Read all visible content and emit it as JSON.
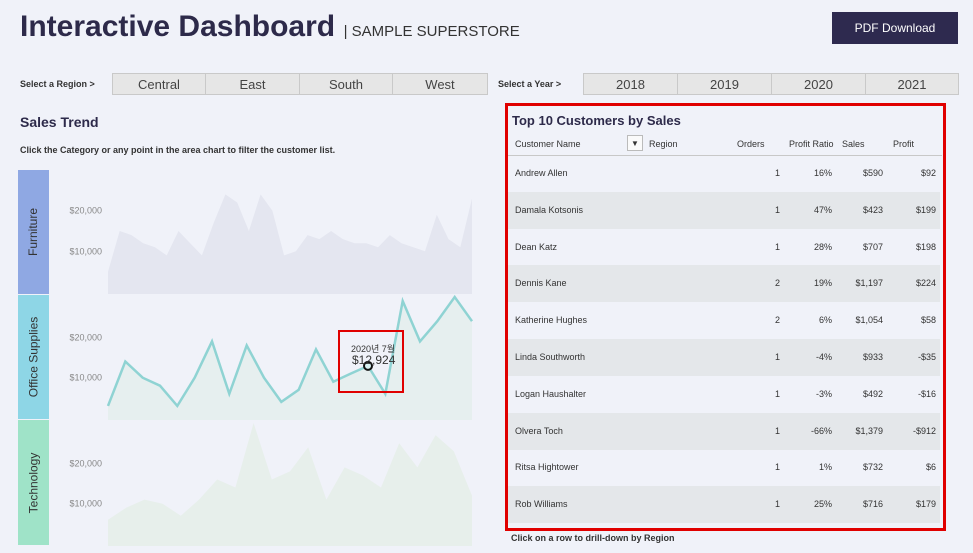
{
  "header": {
    "title": "Interactive Dashboard",
    "subtitle": "| SAMPLE SUPERSTORE",
    "pdf_button": "PDF Download"
  },
  "region_filter": {
    "label": "Select a Region >",
    "options": [
      "Central",
      "East",
      "South",
      "West"
    ]
  },
  "year_filter": {
    "label": "Select a Year >",
    "options": [
      "2018",
      "2019",
      "2020",
      "2021"
    ]
  },
  "sales_trend": {
    "title": "Sales Trend",
    "hint": "Click the Category or any point in the area chart to filter the customer list.",
    "categories": [
      "Furniture",
      "Office Supplies",
      "Technology"
    ],
    "axis_labels": [
      "$20,000",
      "$10,000"
    ],
    "tooltip": {
      "date": "2020년 7월",
      "value": "$12,924"
    }
  },
  "chart_data": {
    "type": "area",
    "title": "Sales Trend",
    "ylabel": "",
    "yticks": [
      10000,
      20000
    ],
    "series": [
      {
        "name": "Furniture",
        "values": [
          5000,
          15000,
          14000,
          12000,
          11000,
          9000,
          15000,
          12000,
          9000,
          17000,
          24000,
          22000,
          15000,
          24000,
          20000,
          9000,
          10000,
          14000,
          13000,
          15000,
          13000,
          12000,
          12000,
          11000,
          14000,
          12000,
          11000,
          10000,
          19000,
          13000,
          11000,
          23000
        ]
      },
      {
        "name": "Office Supplies",
        "values": [
          3000,
          14000,
          10000,
          8000,
          3000,
          10000,
          19000,
          6000,
          18000,
          10000,
          4000,
          7000,
          17000,
          9000,
          11000,
          12924,
          6000,
          29000,
          19000,
          24000,
          38000,
          24000
        ]
      },
      {
        "name": "Technology",
        "values": [
          6000,
          9000,
          11000,
          10000,
          7000,
          11000,
          16000,
          14000,
          34000,
          16000,
          18000,
          24000,
          11000,
          19000,
          17000,
          14000,
          25000,
          19000,
          27000,
          23000,
          12000
        ]
      }
    ]
  },
  "top_customers": {
    "title": "Top 10 Customers by Sales",
    "columns": [
      "Customer Name",
      "Region",
      "Orders",
      "Profit Ratio",
      "Sales",
      "Profit"
    ],
    "rows": [
      {
        "name": "Andrew Allen",
        "orders": "1",
        "ratio": "16%",
        "sales": "$590",
        "profit": "$92"
      },
      {
        "name": "Damala Kotsonis",
        "orders": "1",
        "ratio": "47%",
        "sales": "$423",
        "profit": "$199"
      },
      {
        "name": "Dean Katz",
        "orders": "1",
        "ratio": "28%",
        "sales": "$707",
        "profit": "$198"
      },
      {
        "name": "Dennis Kane",
        "orders": "2",
        "ratio": "19%",
        "sales": "$1,197",
        "profit": "$224"
      },
      {
        "name": "Katherine Hughes",
        "orders": "2",
        "ratio": "6%",
        "sales": "$1,054",
        "profit": "$58"
      },
      {
        "name": "Linda Southworth",
        "orders": "1",
        "ratio": "-4%",
        "sales": "$933",
        "profit": "-$35"
      },
      {
        "name": "Logan Haushalter",
        "orders": "1",
        "ratio": "-3%",
        "sales": "$492",
        "profit": "-$16"
      },
      {
        "name": "Olvera Toch",
        "orders": "1",
        "ratio": "-66%",
        "sales": "$1,379",
        "profit": "-$912"
      },
      {
        "name": "Ritsa Hightower",
        "orders": "1",
        "ratio": "1%",
        "sales": "$732",
        "profit": "$6"
      },
      {
        "name": "Rob Williams",
        "orders": "1",
        "ratio": "25%",
        "sales": "$716",
        "profit": "$179"
      }
    ],
    "footnote": "Click on a row to drill-down by Region"
  },
  "colors": {
    "accent": "#2e2a4f",
    "highlight": "#e00000",
    "furniture": "#8fa8e3",
    "office": "#8ed6e6",
    "technology": "#9fe3c8",
    "line": "#8fd3d3"
  }
}
